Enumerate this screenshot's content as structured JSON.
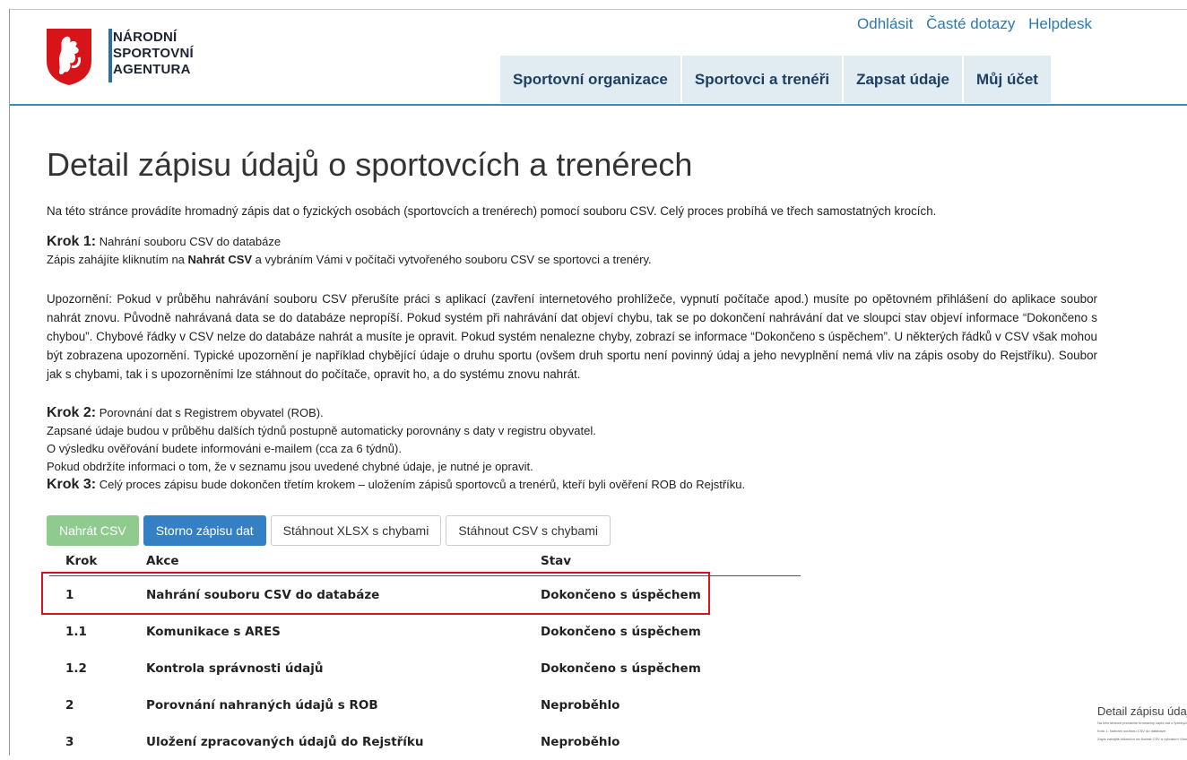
{
  "brand": {
    "line1": "NÁRODNÍ",
    "line2": "SPORTOVNÍ",
    "line3": "AGENTURA",
    "colors": {
      "red": "#d7141a",
      "navy": "#2f6f9e"
    }
  },
  "top_links": [
    "Odhlásit",
    "Časté dotazy",
    "Helpdesk"
  ],
  "nav": [
    "Sportovní organizace",
    "Sportovci a trenéři",
    "Zapsat údaje",
    "Můj účet"
  ],
  "title": "Detail zápisu údajů o sportovcích a trenérech",
  "intro": "Na této stránce provádíte hromadný zápis dat o fyzických osobách (sportovcích a trenérech) pomocí souboru CSV. Celý proces probíhá ve třech samostatných krocích.",
  "step1": {
    "head": "Krok 1:",
    "desc": "Nahrání souboru CSV do databáze",
    "line_pre": "Zápis zahájíte kliknutím na ",
    "line_bold": "Nahrát CSV",
    "line_post": " a vybráním Vámi v počítači vytvořeného souboru CSV se sportovci a trenéry."
  },
  "warning": "Upozornění: Pokud v průběhu nahrávání souboru CSV přerušíte práci s aplikací (zavření internetového prohlížeče, vypnutí počítače apod.) musíte po opětovném přihlášení do aplikace soubor nahrát znovu. Původně nahrávaná data se do databáze nepropíší. Pokud systém při nahrávání dat objeví chybu, tak se po dokončení nahrávání dat ve sloupci stav objeví informace “Dokončeno s chybou”. Chybové řádky v CSV nelze do databáze nahrát a musíte je opravit. Pokud systém nenalezne chyby, zobrazí se informace “Dokončeno s úspěchem”. U některých řádků v CSV však mohou být zobrazena upozornění. Typické upozornění je například chybějící údaje o druhu sportu (ovšem druh sportu není povinný údaj a jeho nevyplnění nemá vliv na zápis osoby do Rejstříku). Soubor jak s chybami, tak i s upozorněními lze stáhnout do počítače, opravit ho, a do systému znovu nahrát.",
  "step2": {
    "head": "Krok 2:",
    "desc": "Porovnání dat s Registrem obyvatel (ROB).",
    "lines": [
      "Zapsané údaje budou v průběhu dalších týdnů postupně automaticky porovnány s daty v registru obyvatel.",
      "O výsledku ověřování budete informováni e-mailem (cca za 6 týdnů).",
      "Pokud obdržíte informaci o tom, že v seznamu jsou uvedené chybné údaje, je nutné je opravit."
    ]
  },
  "step3": {
    "head": "Krok 3:",
    "desc": "Celý proces zápisu bude dokončen třetím krokem – uložením zápisů sportovců a trenérů, kteří byli ověření ROB do Rejstříku."
  },
  "buttons": [
    "Nahrát CSV",
    "Storno zápisu dat",
    "Stáhnout XLSX s chybami",
    "Stáhnout CSV s chybami"
  ],
  "table": {
    "headers": [
      "Krok",
      "Akce",
      "Stav"
    ],
    "rows": [
      [
        "1",
        "Nahrání souboru CSV do databáze",
        "Dokončeno s úspěchem"
      ],
      [
        "1.1",
        "Komunikace s ARES",
        "Dokončeno s úspěchem"
      ],
      [
        "1.2",
        "Kontrola správnosti údajů",
        "Dokončeno s úspěchem"
      ],
      [
        "2",
        "Porovnání nahraných údajů s ROB",
        "Neproběhlo"
      ],
      [
        "3",
        "Uložení zpracovaných údajů do Rejstříku",
        "Neproběhlo"
      ]
    ]
  },
  "thumbnail": {
    "title": "Detail zápisu údajů o sportovcích a trenérech",
    "line1": "Na této stránce provádíte hromadný zápis dat o fyzických osobách",
    "line2": "Krok 1: Nahrání souboru CSV do databáze",
    "line3": "Zápis zahájíte kliknutím na Nahrát CSV a vybráním Vámi v počítači"
  }
}
